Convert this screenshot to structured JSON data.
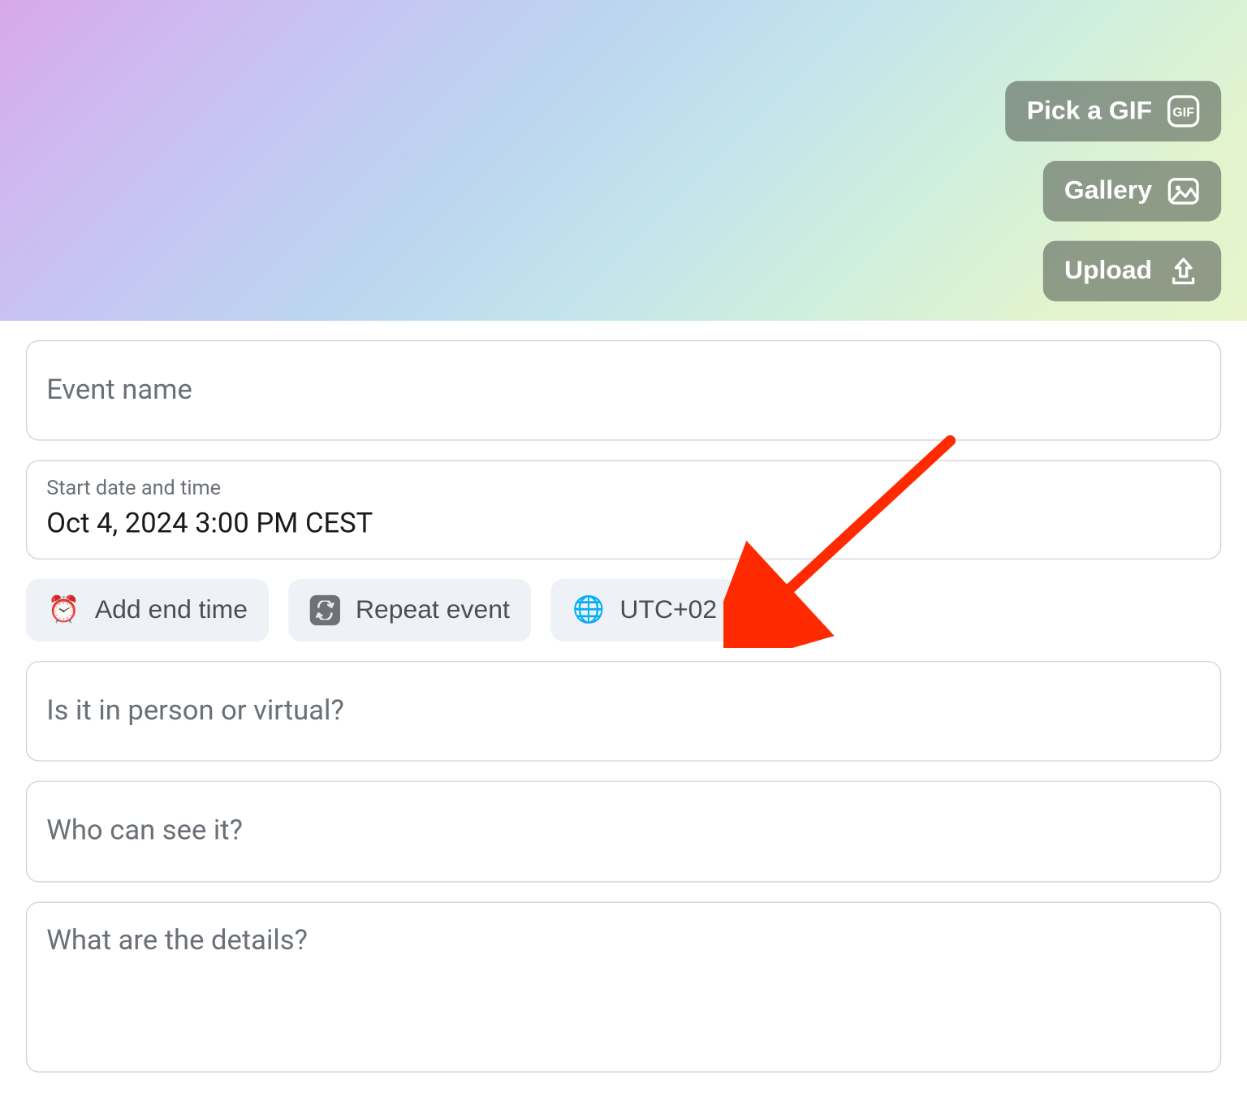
{
  "cover": {
    "pick_gif_label": "Pick a GIF",
    "gallery_label": "Gallery",
    "upload_label": "Upload"
  },
  "form": {
    "event_name_placeholder": "Event name",
    "start": {
      "label": "Start date and time",
      "value": "Oct 4, 2024 3:00 PM CEST"
    },
    "chips": {
      "add_end_time": "Add end time",
      "repeat_event": "Repeat event",
      "timezone": "UTC+02"
    },
    "location_placeholder": "Is it in person or virtual?",
    "visibility_placeholder": "Who can see it?",
    "details_placeholder": "What are the details?"
  },
  "icons": {
    "gif": "GIF",
    "gallery": "gallery",
    "upload": "upload",
    "clock": "⏰",
    "repeat": "🔁",
    "globe": "🌐"
  }
}
